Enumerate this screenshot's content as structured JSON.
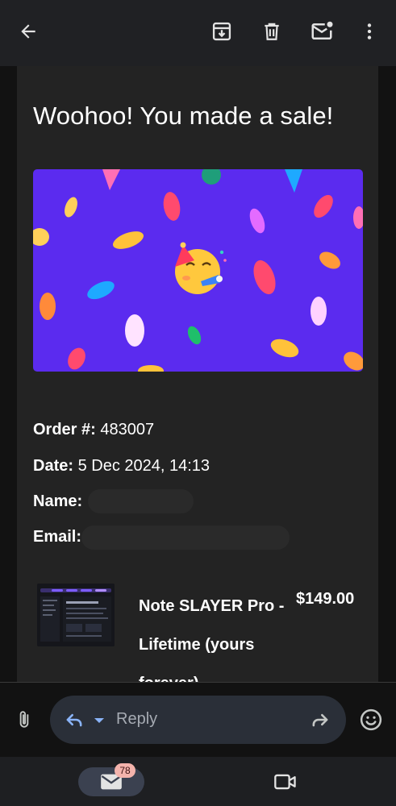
{
  "toolbar": {
    "icons": [
      "back-arrow-icon",
      "archive-icon",
      "delete-icon",
      "mark-unread-icon",
      "more-options-icon"
    ]
  },
  "email": {
    "headline": "Woohoo! You made a sale!",
    "banner": {
      "background": "#5b2bef",
      "emoji": "🥳"
    },
    "order": {
      "number_label": "Order #:",
      "number_value": "483007",
      "date_label": "Date:",
      "date_value": "5 Dec 2024, 14:13",
      "name_label": "Name:",
      "email_label": "Email:"
    },
    "product": {
      "name": "Note SLAYER Pro - Lifetime (yours forever)",
      "price": "$149.00"
    }
  },
  "reply_bar": {
    "placeholder": "Reply",
    "icons": [
      "attachment-icon",
      "reply-icon",
      "forward-icon",
      "emoji-icon"
    ]
  },
  "bottom_nav": {
    "mail_badge": "78",
    "icons": [
      "mail-icon",
      "video-icon"
    ]
  },
  "colors": {
    "toolbar_bg": "#202124",
    "panel_bg": "#232323",
    "reply_pill_bg": "#2a2f38",
    "badge_bg": "#f4b3ac",
    "accent_reply": "#8ab4f8"
  }
}
